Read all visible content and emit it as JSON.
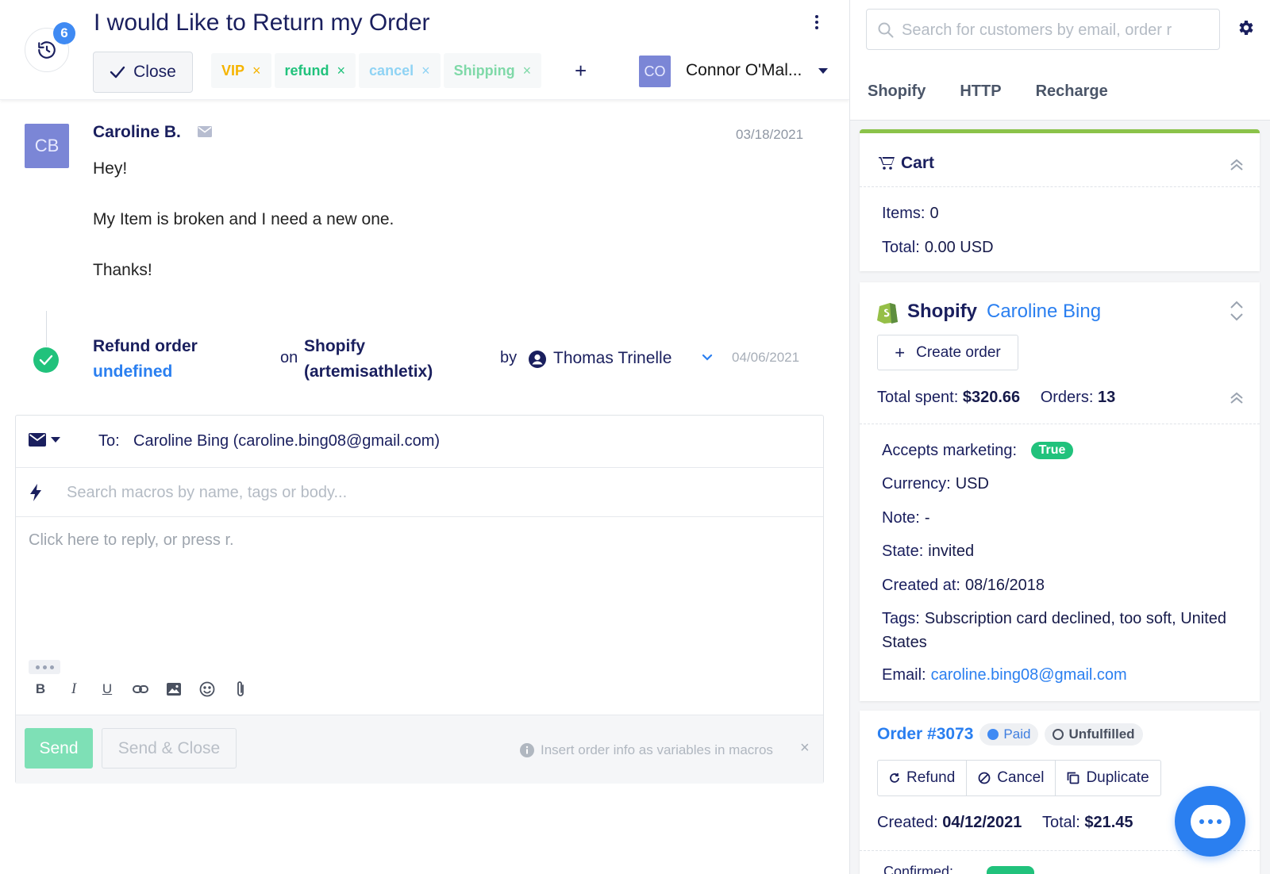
{
  "ticket": {
    "title": "I would Like to Return my Order",
    "history_count": "6",
    "close_label": "Close",
    "tags": [
      {
        "label": "VIP",
        "color": "#f5b400"
      },
      {
        "label": "refund",
        "color": "#21c27c"
      },
      {
        "label": "cancel",
        "color": "#8fd3f4"
      },
      {
        "label": "Shipping",
        "color": "#7fd9a8"
      }
    ],
    "add_tag": "+",
    "assignee": {
      "initials": "CO",
      "name": "Connor O'Mal..."
    }
  },
  "message": {
    "avatar": "CB",
    "sender": "Caroline B.",
    "date": "03/18/2021",
    "lines": [
      "Hey!",
      "My Item is broken and I need a new one.",
      "Thanks!"
    ]
  },
  "event": {
    "action": "Refund order",
    "action_link": "undefined",
    "on": "on",
    "target_line1": "Shopify",
    "target_line2": "(artemisathletix)",
    "by": "by",
    "user": "Thomas Trinelle",
    "date": "04/06/2021"
  },
  "reply": {
    "to_label": "To:",
    "to_value": "Caroline Bing (caroline.bing08@gmail.com)",
    "macro_placeholder": "Search macros by name, tags or body...",
    "body_placeholder": "Click here to reply, or press r.",
    "toolbar": {
      "bold": "B",
      "italic": "I",
      "underline": "U"
    },
    "send": "Send",
    "send_close": "Send & Close",
    "hint": "Insert order info as variables in macros",
    "hint_close": "×"
  },
  "sidebar": {
    "search_placeholder": "Search for customers by email, order r",
    "tabs": [
      "Shopify",
      "HTTP",
      "Recharge"
    ],
    "cart": {
      "title": "Cart",
      "items_label": "Items:",
      "items_value": "0",
      "total_label": "Total:",
      "total_value": "0.00 USD"
    },
    "shopify": {
      "title": "Shopify",
      "customer": "Caroline Bing",
      "create_order": "Create order",
      "create_plus": "+",
      "total_spent_label": "Total spent:",
      "total_spent_value": "$320.66",
      "orders_label": "Orders:",
      "orders_value": "13",
      "accepts_marketing_label": "Accepts marketing:",
      "accepts_marketing_value": "True",
      "currency_label": "Currency:",
      "currency_value": "USD",
      "note_label": "Note:",
      "note_value": "-",
      "state_label": "State:",
      "state_value": "invited",
      "created_label": "Created at:",
      "created_value": "08/16/2018",
      "tags_label": "Tags:",
      "tags_value": "Subscription card declined, too soft, United States",
      "email_label": "Email:",
      "email_value": "caroline.bing08@gmail.com"
    },
    "order": {
      "number": "Order #3073",
      "status_paid": "Paid",
      "status_fulfillment": "Unfulfilled",
      "actions": [
        "Refund",
        "Cancel",
        "Duplicate"
      ],
      "created_label": "Created:",
      "created_value": "04/12/2021",
      "total_label": "Total:",
      "total_value": "$21.45",
      "peek_label": "Confirmed:"
    }
  },
  "colors": {
    "brand_blue": "#2a7ff0",
    "navy": "#1a1f5e",
    "green": "#21c27c",
    "cart_accent": "#8bc34a"
  }
}
